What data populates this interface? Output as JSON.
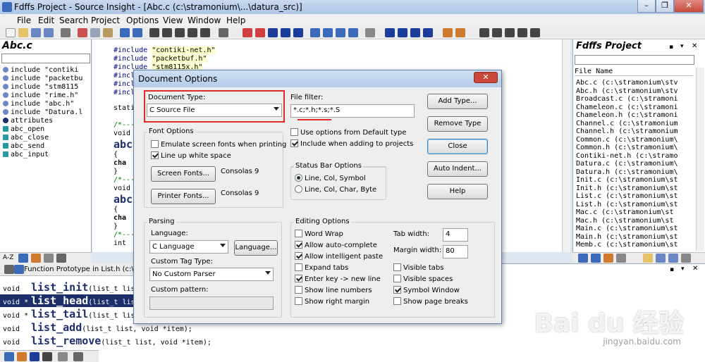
{
  "window": {
    "title": "Fdffs Project - Source Insight - [Abc.c (c:\\stramonium\\...\\datura_src)]",
    "controls": [
      "minimize",
      "restore",
      "close"
    ]
  },
  "menu": [
    "File",
    "Edit",
    "Search",
    "Project",
    "Options",
    "View",
    "Window",
    "Help"
  ],
  "left_panel": {
    "title": "Abc.c",
    "symbols": [
      {
        "text": "include \"contiki",
        "kind": "include"
      },
      {
        "text": "include \"packetbu",
        "kind": "include"
      },
      {
        "text": "include \"stm8115",
        "kind": "include"
      },
      {
        "text": "include \"rime.h\"",
        "kind": "include"
      },
      {
        "text": "include \"abc.h\"",
        "kind": "include"
      },
      {
        "text": "include \"Datura.l",
        "kind": "include"
      },
      {
        "text": "attributes",
        "kind": "attribute"
      },
      {
        "text": "abc_open",
        "kind": "function"
      },
      {
        "text": "abc_close",
        "kind": "function"
      },
      {
        "text": "abc_send",
        "kind": "function"
      },
      {
        "text": "abc_input",
        "kind": "function"
      }
    ],
    "tab_label": "A-Z"
  },
  "editor": {
    "lines": [
      {
        "pre": "#include ",
        "str": "\"contiki-net.h\""
      },
      {
        "pre": "#include ",
        "str": "\"packetbuf.h\""
      },
      {
        "pre": "#include ",
        "str": "\"stm8115x.h\""
      },
      {
        "pre": "#incl",
        "str": ""
      },
      {
        "pre": "#incl",
        "str": ""
      },
      {
        "pre": "#incl",
        "str": ""
      },
      {
        "pre": "stati",
        "str": ""
      },
      {
        "pre": "/*---",
        "str": ""
      },
      {
        "pre": "void",
        "str": ""
      },
      {
        "pre": "abc",
        "str": ""
      },
      {
        "pre": "{",
        "str": ""
      },
      {
        "pre": "  cha",
        "str": ""
      },
      {
        "pre": "}",
        "str": ""
      },
      {
        "pre": "/*---",
        "str": ""
      },
      {
        "pre": "void",
        "str": ""
      },
      {
        "pre": "abc",
        "str": ""
      },
      {
        "pre": "{",
        "str": ""
      },
      {
        "pre": "  cha",
        "str": ""
      },
      {
        "pre": "}",
        "str": ""
      },
      {
        "pre": "/*---",
        "str": ""
      },
      {
        "pre": "int",
        "str": ""
      }
    ]
  },
  "right_panel": {
    "title": "Fdffs Project",
    "column_header": "File Name",
    "files": [
      "Abc.c (c:\\stramonium\\stv",
      "Abc.h (c:\\stramonium\\stv",
      "Broadcast.c (c:\\stramoni",
      "Chameleon.c (c:\\stramoni",
      "Chameleon.h (c:\\stramoni",
      "Channel.c (c:\\stramonium",
      "Channel.h (c:\\stramonium",
      "Common.c (c:\\stramonium\\",
      "Common.h (c:\\stramonium\\",
      "Contiki-net.h (c:\\stramo",
      "Datura.c (c:\\stramonium\\",
      "Datura.h (c:\\stramonium\\",
      "Init.c (c:\\stramonium\\st",
      "Init.h (c:\\stramonium\\st",
      "List.c (c:\\stramonium\\st",
      "List.h (c:\\stramonium\\st",
      "Mac.c (c:\\stramonium\\st",
      "Mac.h (c:\\stramonium\\st",
      "Main.c (c:\\stramonium\\st",
      "Main.h (c:\\stramonium\\st",
      "Memb.c (c:\\stramonium\\st"
    ]
  },
  "bottom_panel": {
    "title": "Function Prototype in List.h (c:\\strar",
    "prototypes": [
      {
        "ret": "void",
        "name": "list_init",
        "args": "(list_t lis",
        "selected": false
      },
      {
        "ret": "void *",
        "name": "list_head",
        "args": "(list_t lis",
        "selected": true
      },
      {
        "ret": "void *",
        "name": "list_tail",
        "args": "(list_t lis",
        "selected": false
      },
      {
        "ret": "void",
        "name": "list_add",
        "args": "(list_t list, void *item);",
        "selected": false
      },
      {
        "ret": "void",
        "name": "list_remove",
        "args": "(list_t list, void *item);",
        "selected": false
      }
    ]
  },
  "dialog": {
    "title": "Document Options",
    "close_glyph": "✕",
    "document_type_label": "Document Type:",
    "document_type_value": "C Source File",
    "file_filter_label": "File filter:",
    "file_filter_value": "*.c;*.h;*.s;*.S",
    "buttons": {
      "add_type": "Add Type...",
      "remove_type": "Remove Type",
      "close": "Close",
      "auto_indent": "Auto Indent...",
      "help": "Help",
      "screen_fonts": "Screen Fonts...",
      "printer_fonts": "Printer Fonts...",
      "language": "Language..."
    },
    "use_default_type": {
      "label": "Use options from Default type",
      "checked": false
    },
    "include_projects": {
      "label": "Include when adding to projects",
      "checked": true
    },
    "font_options": {
      "title": "Font Options",
      "emulate": {
        "label": "Emulate screen fonts when printing",
        "checked": false
      },
      "line_up": {
        "label": "Line up white space",
        "checked": true
      },
      "screen_font_name": "Consolas 9",
      "printer_font_name": "Consolas 9"
    },
    "status_bar": {
      "title": "Status Bar Options",
      "opt1": {
        "label": "Line, Col, Symbol",
        "checked": true
      },
      "opt2": {
        "label": "Line, Col, Char, Byte",
        "checked": false
      }
    },
    "parsing": {
      "title": "Parsing",
      "language_label": "Language:",
      "language_value": "C Language",
      "custom_tag_label": "Custom Tag Type:",
      "custom_tag_value": "No Custom Parser",
      "custom_pattern_label": "Custom pattern:",
      "custom_pattern_value": ""
    },
    "editing": {
      "title": "Editing Options",
      "left": [
        {
          "label": "Word Wrap",
          "checked": false
        },
        {
          "label": "Allow auto-complete",
          "checked": true
        },
        {
          "label": "Allow intelligent paste",
          "checked": true
        },
        {
          "label": "Expand tabs",
          "checked": false
        },
        {
          "label": "Enter key -> new line",
          "checked": true
        },
        {
          "label": "Show line numbers",
          "checked": false
        },
        {
          "label": "Show right margin",
          "checked": false
        }
      ],
      "tab_width_label": "Tab width:",
      "tab_width_value": "4",
      "margin_width_label": "Margin width:",
      "margin_width_value": "80",
      "right": [
        {
          "label": "Visible tabs",
          "checked": false
        },
        {
          "label": "Visible spaces",
          "checked": false
        },
        {
          "label": "Symbol Window",
          "checked": true
        },
        {
          "label": "Show page breaks",
          "checked": false
        }
      ]
    }
  },
  "watermark": {
    "text": "Bai du 经验",
    "url": "jingyan.baidu.com"
  },
  "colors": {
    "highlight": "#e02b2b",
    "selection": "#1c2f6b",
    "accent": "#3a6ab8"
  }
}
